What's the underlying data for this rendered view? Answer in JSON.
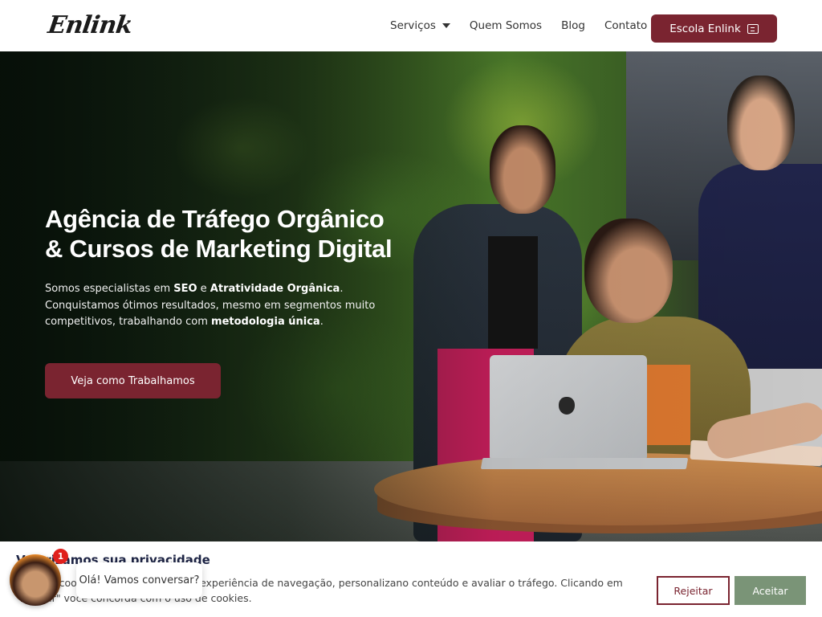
{
  "header": {
    "logo": "Enlink",
    "nav": [
      {
        "label": "Serviços",
        "has_dropdown": true
      },
      {
        "label": "Quem Somos"
      },
      {
        "label": "Blog"
      },
      {
        "label": "Contato"
      }
    ],
    "cta_label": "Escola Enlink"
  },
  "hero": {
    "title_line1": "Agência de Tráfego Orgânico",
    "title_line2": "& Cursos de Marketing Digital",
    "desc": {
      "p1": "Somos especialistas em ",
      "b1": "SEO",
      "p2": " e ",
      "b2": "Atratividade Orgânica",
      "p3": ". Conquistamos ótimos resultados, mesmo em segmentos muito competitivos, trabalhando com ",
      "b3": "metodologia única",
      "p4": "."
    },
    "button_label": "Veja como Trabalhamos"
  },
  "cookie": {
    "title": "Valorizamos sua privacidade",
    "text": "Usamos cookies para aprimorar sua experiência de navegação, personalizano conteúdo e avaliar o tráfego. Clicando em \"Aceitar\" você concorda com o uso de cookies.",
    "reject_label": "Rejeitar",
    "accept_label": "Aceitar"
  },
  "chat": {
    "badge_count": "1",
    "message": "Olá! Vamos conversar?"
  },
  "colors": {
    "brand": "#7a2430",
    "accept": "#7a9477"
  }
}
